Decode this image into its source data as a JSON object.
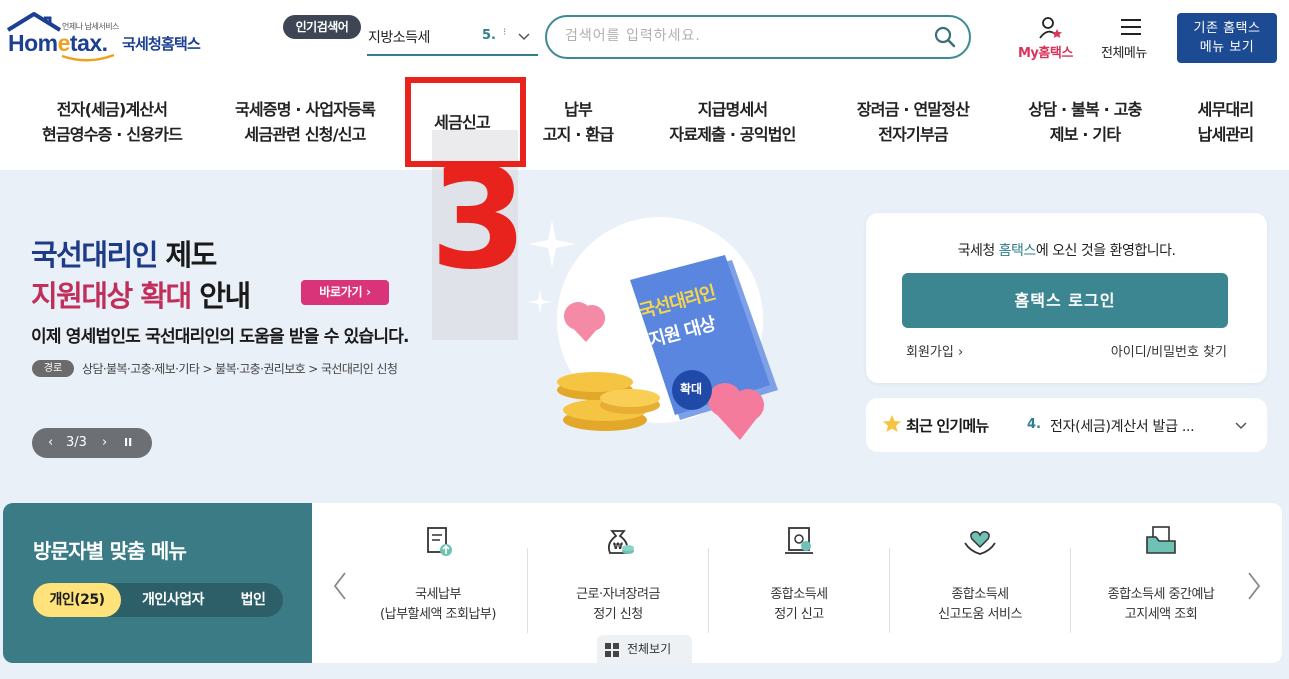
{
  "header": {
    "logo_small": "언제나 납세서비스",
    "logo_main_a": "Hom",
    "logo_main_e": "e",
    "logo_main_b": "tax.",
    "logo_kr": "국세청홈택스",
    "popular_badge": "인기검색어",
    "popular_term": "지방소득세",
    "popular_rank": "5.",
    "popular_dots": "⁝",
    "search_placeholder": "검색어를 입력하세요.",
    "my_label": "My홈택스",
    "menu_label": "전체메뉴",
    "old_btn_line1": "기존 홈택스",
    "old_btn_line2": "메뉴 보기"
  },
  "gnb": [
    {
      "l1": "전자(세금)계산서",
      "l2": "현금영수증 · 신용카드"
    },
    {
      "l1": "국세증명 · 사업자등록",
      "l2": "세금관련 신청/신고"
    },
    {
      "l1": "세금신고",
      "l2": ""
    },
    {
      "l1": "납부",
      "l2": "고지 · 환급"
    },
    {
      "l1": "지급명세서",
      "l2": "자료제출 · 공익법인"
    },
    {
      "l1": "장려금 · 연말정산",
      "l2": "전자기부금"
    },
    {
      "l1": "상담 · 불복 · 고충",
      "l2": "제보 · 기타"
    },
    {
      "l1": "세무대리",
      "l2": "납세관리"
    }
  ],
  "hero": {
    "t1_a": "국선대리인",
    "t1_b": " 제도",
    "t2_a": "지원대상 확대",
    "t2_b": " 안내",
    "go_btn": "바로가기 ›",
    "desc": "이제 영세법인도 국선대리인의 도움을 받을 수 있습니다.",
    "path_badge": "경로",
    "path_text": "상담·불복·고충·제보·기타 > 불복·고충·권리보호 > 국선대리인 신청",
    "pager_prev": "‹",
    "pager_count": "3/3",
    "pager_next": "›",
    "pager_pause": "II",
    "book_line1": "국선대리인",
    "book_line2": "지원 대상",
    "book_badge": "확대"
  },
  "login": {
    "welcome_a": "국세청 ",
    "welcome_hl": "홈택스",
    "welcome_b": "에 오신 것을 환영합니다.",
    "login_btn": "홈택스 로그인",
    "join": "회원가입 ›",
    "find": "아이디/비밀번호 찾기"
  },
  "recent": {
    "title": "최근 인기메뉴",
    "rank": "4.",
    "item": "전자(세금)계산서 발급 ..."
  },
  "visitor": {
    "title": "방문자별 맞춤 메뉴",
    "tabs": [
      "개인(25)",
      "개인사업자",
      "법인"
    ],
    "items": [
      {
        "l1": "국세납부",
        "l2": "(납부할세액 조회납부)"
      },
      {
        "l1": "근로·자녀장려금",
        "l2": "정기 신청"
      },
      {
        "l1": "종합소득세",
        "l2": "정기 신고"
      },
      {
        "l1": "종합소득세",
        "l2": "신고도움 서비스"
      },
      {
        "l1": "종합소득세 중간예납",
        "l2": "고지세액 조회"
      }
    ],
    "all_view": "전체보기"
  },
  "overlay": {
    "number": "3"
  },
  "colors": {
    "brand_navy": "#1c3f94",
    "teal": "#3c8692",
    "pink": "#d9347a",
    "red_annotation": "#e8231e"
  }
}
